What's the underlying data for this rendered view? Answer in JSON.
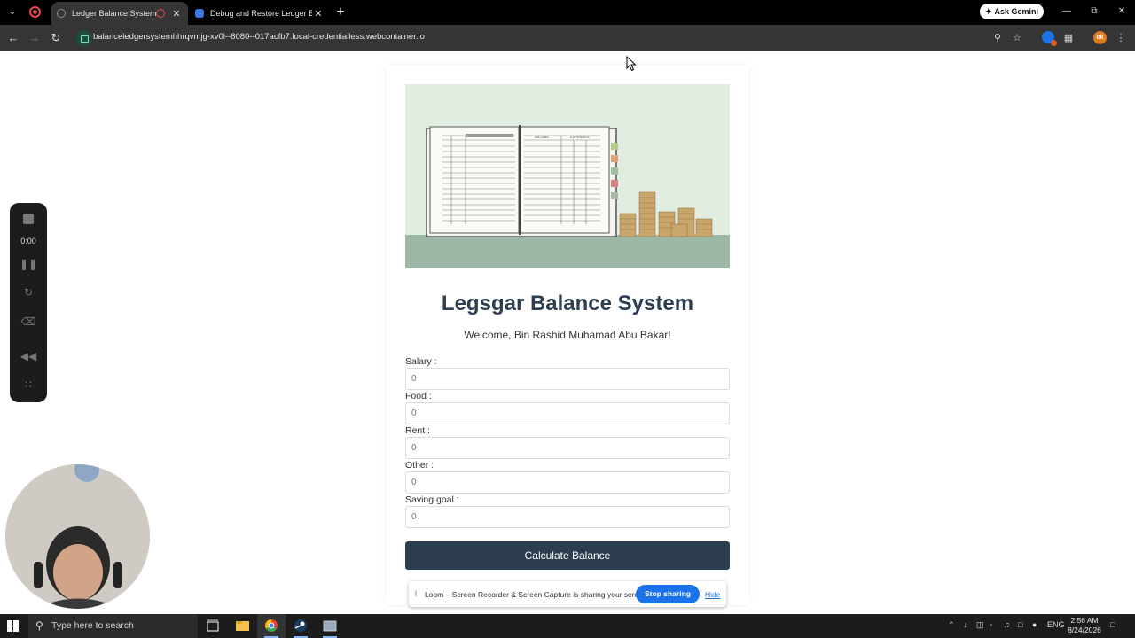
{
  "browser": {
    "tabs": [
      {
        "title": "Ledger Balance System",
        "active": true
      },
      {
        "title": "Debug and Restore Ledger Balance",
        "active": false
      }
    ],
    "new_tab": "+",
    "gemini_label": "Ask Gemini",
    "url": "balanceledgersystemhhrqvmjg-xv0l--8080--017acfb7.local-credentialless.webcontainer.io",
    "profile_initials": "ok"
  },
  "app": {
    "title": "Legsgar Balance System",
    "welcome": "Welcome, Bin Rashid Muhamad Abu Bakar!",
    "fields": [
      {
        "label": "Salary :",
        "value": "0"
      },
      {
        "label": "Food :",
        "value": "0"
      },
      {
        "label": "Rent :",
        "value": "0"
      },
      {
        "label": "Other :",
        "value": "0"
      },
      {
        "label": "Saving goal :",
        "value": "0"
      }
    ],
    "calculate_label": "Calculate Balance",
    "ledger_headers": [
      "INCOME",
      "EXPENSES"
    ]
  },
  "loom": {
    "timer": "0:00",
    "share_text": "Loom – Screen Recorder & Screen Capture is sharing your screen.",
    "stop_label": "Stop sharing",
    "hide_label": "Hide"
  },
  "taskbar": {
    "search_placeholder": "Type here to search",
    "language": "ENG",
    "time": "2:56 AM",
    "date": "8/24/2026"
  },
  "colors": {
    "primary": "#2c3e50",
    "hero_bg": "#e2ede2",
    "hero_floor": "#9db8a6",
    "coins": "#c9a66b",
    "loom_blue": "#1a73e8"
  }
}
